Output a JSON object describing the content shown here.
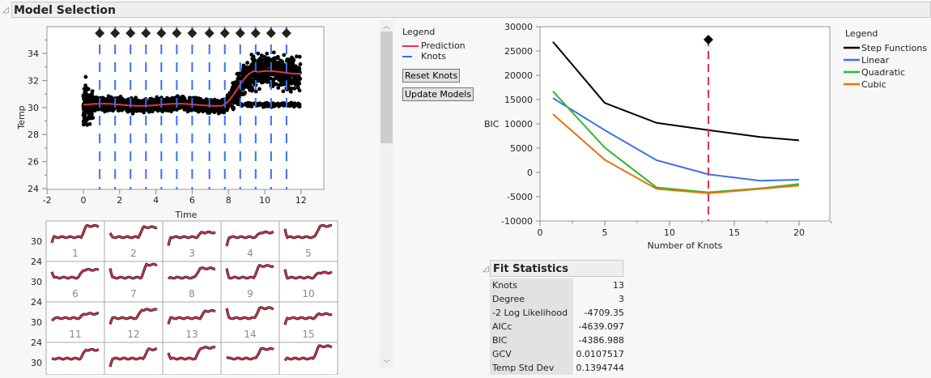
{
  "header": {
    "title": "Model Selection"
  },
  "main_plot": {
    "ylabel": "Temp",
    "xlabel": "Time",
    "xticks": [
      -2,
      0,
      2,
      4,
      6,
      8,
      10,
      12
    ],
    "yticks": [
      24,
      26,
      28,
      30,
      32,
      34
    ],
    "knots": [
      0.9,
      1.75,
      2.6,
      3.45,
      4.3,
      5.15,
      6.0,
      6.95,
      7.8,
      8.65,
      9.5,
      10.35,
      11.2
    ]
  },
  "legend": {
    "title": "Legend",
    "items": [
      {
        "label": "Prediction",
        "color": "#e8304a"
      },
      {
        "label": "Knots",
        "color": "#3a6ff0"
      }
    ]
  },
  "buttons": {
    "reset": "Reset Knots",
    "update": "Update Models"
  },
  "small_multiples": {
    "yticks": [
      30,
      24,
      30,
      24,
      30,
      24,
      30
    ],
    "labels": [
      "1",
      "2",
      "3",
      "4",
      "5",
      "6",
      "7",
      "8",
      "9",
      "10",
      "11",
      "12",
      "13",
      "14",
      "15"
    ]
  },
  "chart_data": {
    "type": "line",
    "ylabel": "BIC",
    "xlabel": "Number of Knots",
    "xlim": [
      0,
      22.5
    ],
    "ylim": [
      -10000,
      30000
    ],
    "xticks": [
      0,
      5,
      10,
      15,
      20
    ],
    "yticks": [
      30000,
      25000,
      20000,
      15000,
      10000,
      5000,
      0,
      -5000,
      -10000
    ],
    "x": [
      1,
      5,
      9,
      13,
      17,
      20
    ],
    "selected_knots": 13,
    "legend_title": "Legend",
    "series": [
      {
        "name": "Step Functions",
        "color": "#000000",
        "values": [
          26900,
          14300,
          10200,
          8700,
          7300,
          6600
        ]
      },
      {
        "name": "Linear",
        "color": "#3a6ff0",
        "values": [
          15300,
          8700,
          2500,
          -400,
          -1700,
          -1500
        ]
      },
      {
        "name": "Quadratic",
        "color": "#2db82d",
        "values": [
          16700,
          5100,
          -3100,
          -4100,
          -3300,
          -2400
        ]
      },
      {
        "name": "Cubic",
        "color": "#e8720c",
        "values": [
          12000,
          2600,
          -3400,
          -4300,
          -3400,
          -2700
        ]
      }
    ]
  },
  "fit_statistics": {
    "title": "Fit Statistics",
    "rows": [
      {
        "label": "Knots",
        "value": "13"
      },
      {
        "label": "Degree",
        "value": "3"
      },
      {
        "label": "-2 Log Likelihood",
        "value": "-4709.35"
      },
      {
        "label": "AICc",
        "value": "-4639.097"
      },
      {
        "label": "BIC",
        "value": "-4386.988"
      },
      {
        "label": "GCV",
        "value": "0.0107517"
      },
      {
        "label": "Temp Std Dev",
        "value": "0.1394744"
      }
    ]
  }
}
